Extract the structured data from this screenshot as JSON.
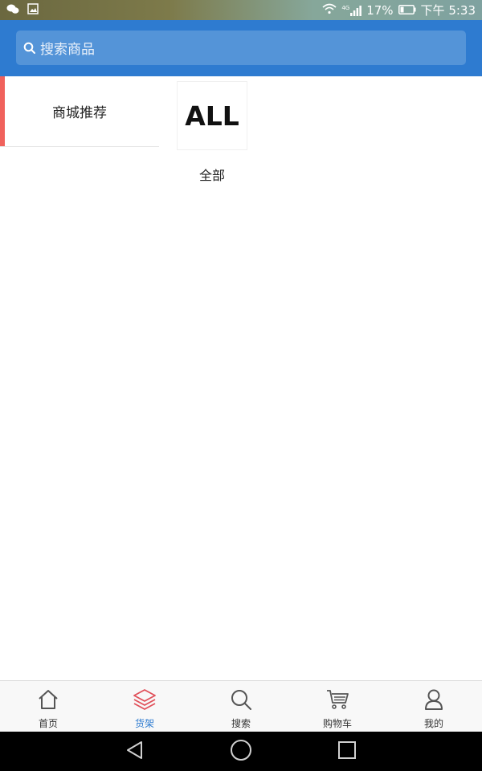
{
  "status_bar": {
    "signal_label": "4G",
    "battery": "17%",
    "time": "下午 5:33"
  },
  "search": {
    "placeholder": "搜索商品"
  },
  "sidebar": {
    "items": [
      {
        "label": "商城推荐",
        "active": true
      }
    ]
  },
  "content": {
    "categories": [
      {
        "thumb_text": "ALL",
        "label": "全部"
      }
    ]
  },
  "tabbar": {
    "tabs": [
      {
        "label": "首页",
        "icon": "home-icon"
      },
      {
        "label": "货架",
        "icon": "layers-icon",
        "active": true
      },
      {
        "label": "搜索",
        "icon": "search-icon"
      },
      {
        "label": "购物车",
        "icon": "cart-icon"
      },
      {
        "label": "我的",
        "icon": "user-icon"
      }
    ]
  },
  "colors": {
    "header": "#2e7bd0",
    "search_box": "#5494d8",
    "active_indicator": "#f0625c",
    "active_tab_text": "#2e7bd0",
    "active_tab_icon": "#e0505a"
  }
}
